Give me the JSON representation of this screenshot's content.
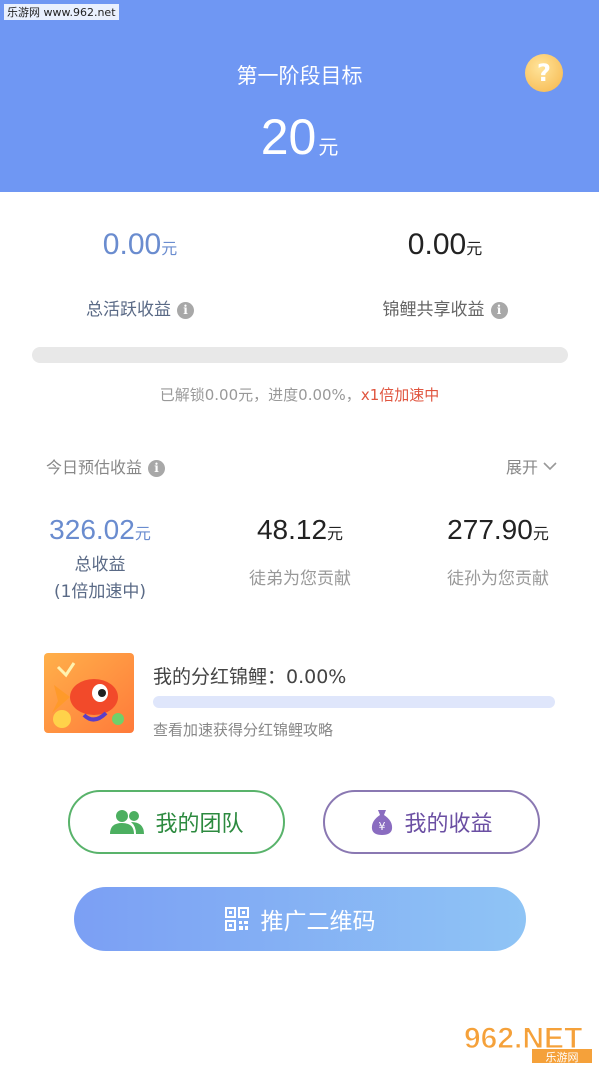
{
  "watermark_top": "乐游网 www.962.net",
  "header": {
    "title": "第一阶段目标",
    "target_value": "20",
    "unit": "元",
    "help_label": "?"
  },
  "summary": {
    "active": {
      "value": "0.00",
      "unit": "元",
      "label": "总活跃收益",
      "color": "#6a8ccf"
    },
    "koi": {
      "value": "0.00",
      "unit": "元",
      "label": "锦鲤共享收益"
    }
  },
  "progress": {
    "percent": 0.0,
    "unlock_text": "已解锁0.00元，进度0.00%，",
    "speed_text": "x1倍加速中"
  },
  "today": {
    "label": "今日预估收益",
    "expand": "展开",
    "total": {
      "value": "326.02",
      "unit": "元",
      "label": "总收益",
      "sub": "(1倍加速中)"
    },
    "disciples": {
      "value": "48.12",
      "unit": "元",
      "label": "徒弟为您贡献"
    },
    "grand_disciples": {
      "value": "277.90",
      "unit": "元",
      "label": "徒孙为您贡献"
    }
  },
  "koi_dividend": {
    "title": "我的分红锦鲤：0.00%",
    "percent": 0.0,
    "hint": "查看加速获得分红锦鲤攻略"
  },
  "buttons": {
    "team": "我的团队",
    "income": "我的收益",
    "promo": "推广二维码"
  },
  "watermark_bottom": {
    "big": "962.NET",
    "small": "乐游网"
  },
  "icons": {
    "help": "question-icon",
    "info": "info-icon",
    "expand": "chevron-down-icon",
    "team": "users-icon",
    "income": "money-bag-icon",
    "promo": "qr-code-icon"
  }
}
